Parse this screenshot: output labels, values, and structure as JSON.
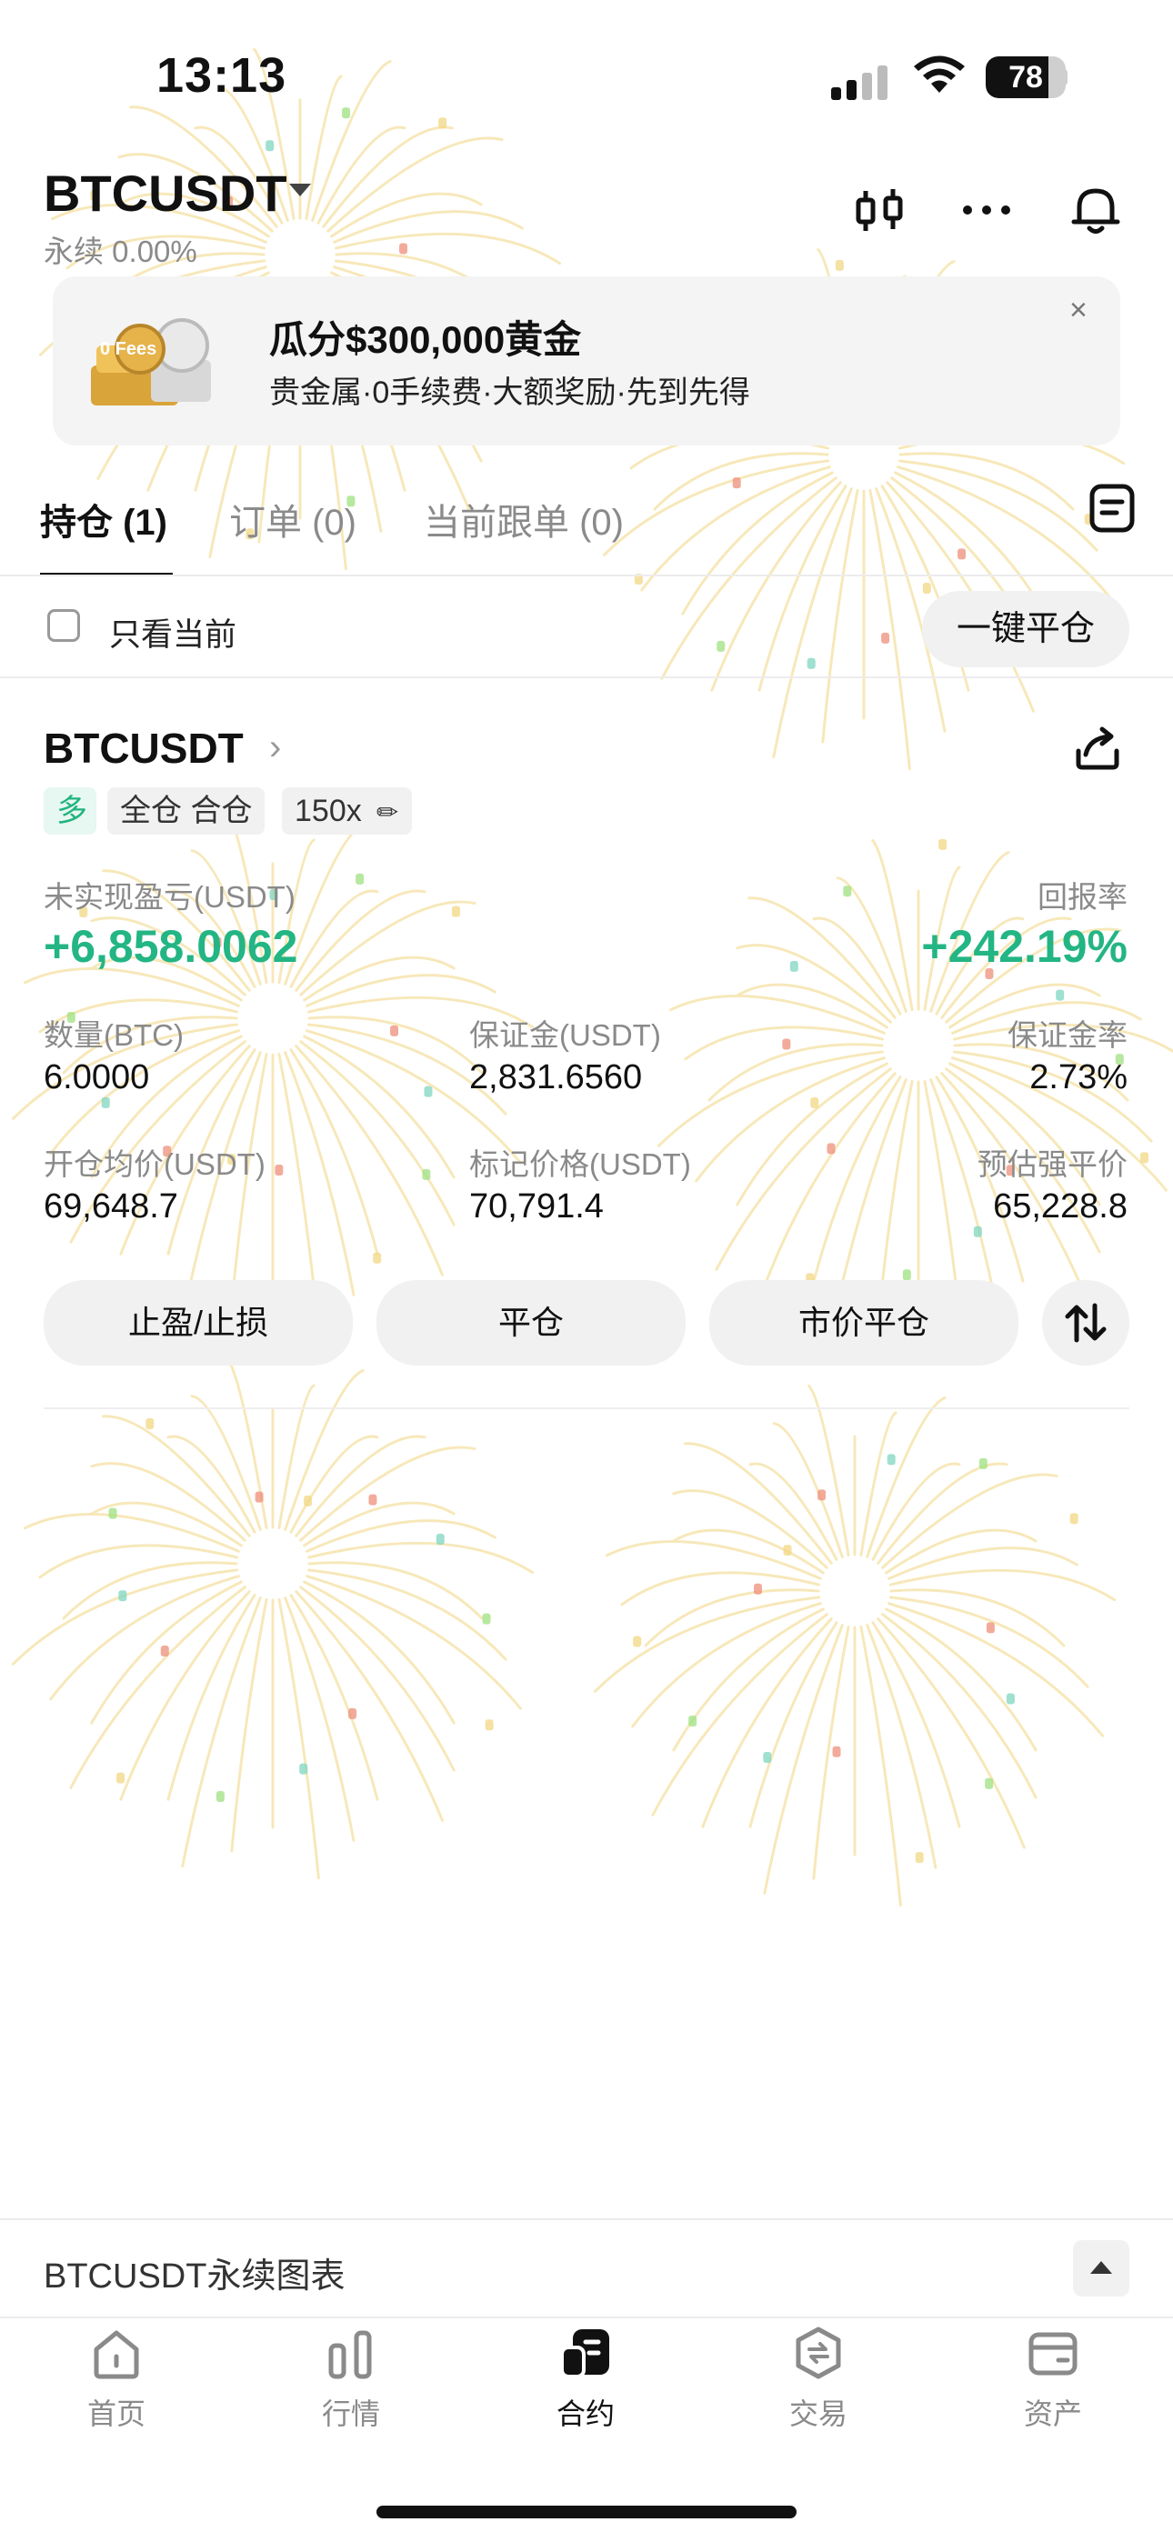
{
  "status_bar": {
    "time": "13:13",
    "battery": "78",
    "battery_level": 0.78
  },
  "header": {
    "pair": "BTCUSDT",
    "subtitle": "永续 0.00%"
  },
  "banner": {
    "title": "瓜分$300,000黄金",
    "subtitle": "贵金属·0手续费·大额奖励·先到先得",
    "image_text": "0 Fees",
    "close": "×"
  },
  "tabs": [
    {
      "label": "持仓 (1)"
    },
    {
      "label": "订单 (0)"
    },
    {
      "label": "当前跟单 (0)"
    }
  ],
  "filter": {
    "label": "只看当前",
    "close_all": "一键平仓"
  },
  "position": {
    "symbol": "BTCUSDT",
    "side": "多",
    "mode": "全仓 合仓",
    "leverage": "150x",
    "pnl_label": "未实现盈亏(USDT)",
    "pnl_value": "+6,858.0062",
    "roi_label": "回报率",
    "roi_value": "+242.19%",
    "qty_label": "数量(BTC)",
    "qty_value": "6.0000",
    "margin_label": "保证金(USDT)",
    "margin_value": "2,831.6560",
    "margin_ratio_label": "保证金率",
    "margin_ratio_value": "2.73%",
    "entry_label": "开仓均价(USDT)",
    "entry_value": "69,648.7",
    "mark_label": "标记价格(USDT)",
    "mark_value": "70,791.4",
    "liq_label": "预估强平价",
    "liq_value": "65,228.8"
  },
  "actions": {
    "tpsl": "止盈/止损",
    "close": "平仓",
    "market_close": "市价平仓"
  },
  "chart_bar": {
    "label": "BTCUSDT永续图表"
  },
  "nav": [
    {
      "label": "首页"
    },
    {
      "label": "行情"
    },
    {
      "label": "合约"
    },
    {
      "label": "交易"
    },
    {
      "label": "资产"
    }
  ],
  "colors": {
    "profit": "#23b584",
    "long_tag_bg": "#e7f7f1",
    "text": "#111111",
    "muted": "#8a8a8a"
  },
  "icons": [
    "candlestick-icon",
    "more-icon",
    "bell-icon",
    "document-icon",
    "share-icon",
    "swap-icon",
    "home-icon",
    "market-icon",
    "futures-icon",
    "trade-icon",
    "wallet-icon"
  ]
}
